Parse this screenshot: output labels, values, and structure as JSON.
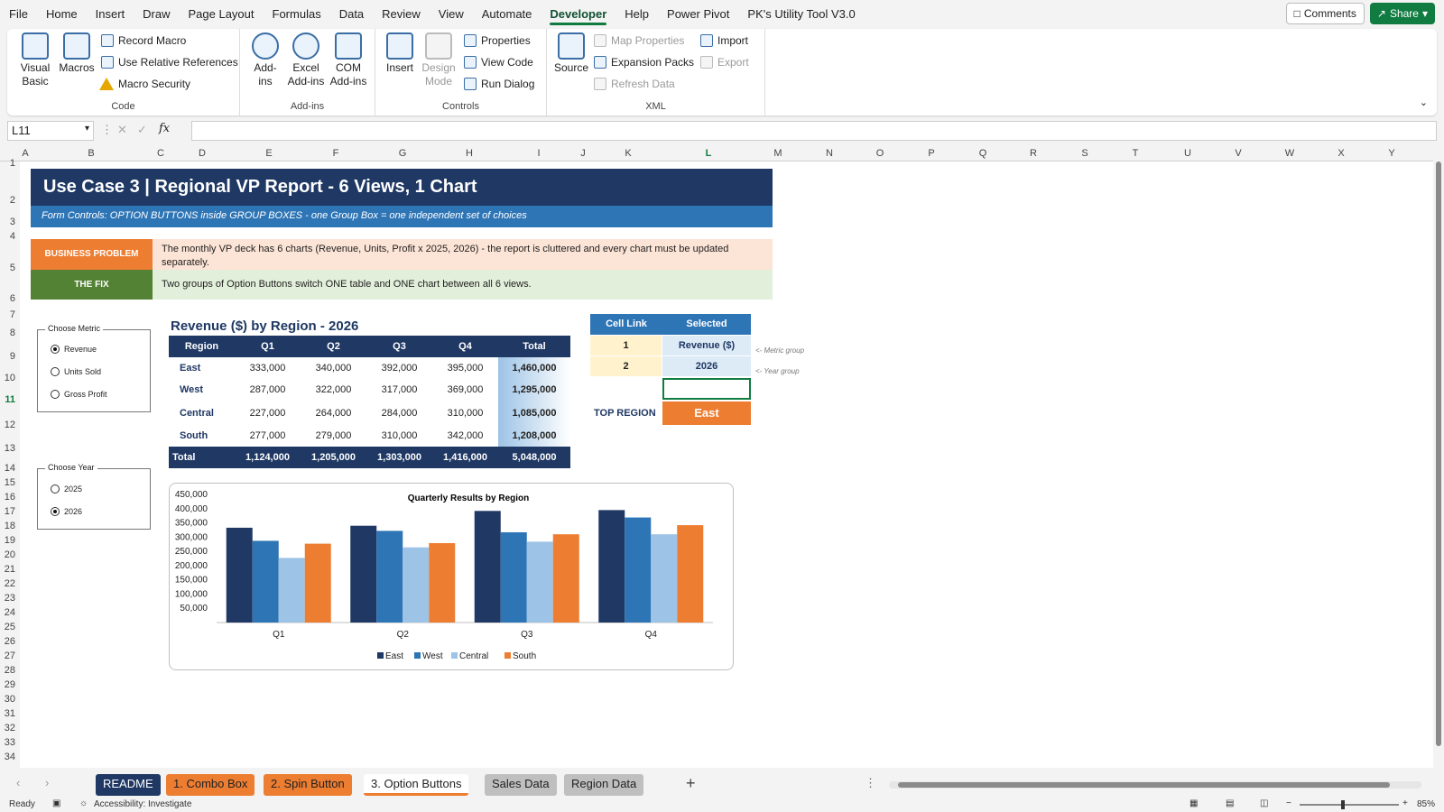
{
  "menu": {
    "tabs": [
      "File",
      "Home",
      "Insert",
      "Draw",
      "Page Layout",
      "Formulas",
      "Data",
      "Review",
      "View",
      "Automate",
      "Developer",
      "Help",
      "Power Pivot",
      "PK's Utility Tool V3.0"
    ],
    "active": "Developer",
    "comments": "Comments",
    "share": "Share"
  },
  "ribbon": {
    "code": {
      "label": "Code",
      "visual_basic": "Visual Basic",
      "macros": "Macros",
      "record_macro": "Record Macro",
      "relative_refs": "Use Relative References",
      "macro_security": "Macro Security"
    },
    "addins": {
      "label": "Add-ins",
      "addins": "Add-ins",
      "excel_addins": "Excel Add-ins",
      "com_addins": "COM Add-ins"
    },
    "controls": {
      "label": "Controls",
      "insert": "Insert",
      "design_mode": "Design Mode",
      "properties": "Properties",
      "view_code": "View Code",
      "run_dialog": "Run Dialog"
    },
    "xml": {
      "label": "XML",
      "source": "Source",
      "map_properties": "Map Properties",
      "expansion_packs": "Expansion Packs",
      "refresh_data": "Refresh Data",
      "import": "Import",
      "export": "Export"
    }
  },
  "formula_bar": {
    "name_box": "L11",
    "formula": ""
  },
  "columns": [
    "A",
    "B",
    "C",
    "D",
    "E",
    "F",
    "G",
    "H",
    "I",
    "J",
    "K",
    "L",
    "M",
    "N",
    "O",
    "P",
    "Q",
    "R",
    "S",
    "T",
    "U",
    "V",
    "W",
    "X",
    "Y"
  ],
  "rows": [
    "1",
    "2",
    "3",
    "4",
    "5",
    "6",
    "7",
    "8",
    "9",
    "10",
    "11",
    "12",
    "13",
    "14",
    "15",
    "16",
    "17",
    "18",
    "19",
    "20",
    "21",
    "22",
    "23",
    "24",
    "25",
    "26",
    "27",
    "28",
    "29",
    "30",
    "31",
    "32",
    "33",
    "34"
  ],
  "sheet": {
    "title": "Use Case 3  |  Regional VP Report - 6 Views, 1 Chart",
    "subtitle": "Form Controls: OPTION BUTTONS inside GROUP BOXES   -   one Group Box = one independent set of choices",
    "business_problem_label": "BUSINESS PROBLEM",
    "business_problem_text": "The monthly VP deck has 6 charts (Revenue, Units, Profit x 2025, 2026) - the report is cluttered and every chart must be updated separately.",
    "fix_label": "THE FIX",
    "fix_text": "Two groups of Option Buttons switch ONE table and ONE chart between all 6 views.",
    "metric_group": {
      "title": "Choose Metric",
      "options": [
        "Revenue",
        "Units Sold",
        "Gross Profit"
      ],
      "selected": 0
    },
    "year_group": {
      "title": "Choose Year",
      "options": [
        "2025",
        "2026"
      ],
      "selected": 1
    },
    "table_title": "Revenue ($)  by Region  -  2026",
    "table": {
      "headers": [
        "Region",
        "Q1",
        "Q2",
        "Q3",
        "Q4",
        "Total"
      ],
      "rows": [
        [
          "East",
          "333,000",
          "340,000",
          "392,000",
          "395,000",
          "1,460,000"
        ],
        [
          "West",
          "287,000",
          "322,000",
          "317,000",
          "369,000",
          "1,295,000"
        ],
        [
          "Central",
          "227,000",
          "264,000",
          "284,000",
          "310,000",
          "1,085,000"
        ],
        [
          "South",
          "277,000",
          "279,000",
          "310,000",
          "342,000",
          "1,208,000"
        ]
      ],
      "total": [
        "Total",
        "1,124,000",
        "1,205,000",
        "1,303,000",
        "1,416,000",
        "5,048,000"
      ]
    },
    "cell_link": {
      "headers": [
        "Cell Link",
        "Selected"
      ],
      "rows": [
        [
          "1",
          "Revenue ($)"
        ],
        [
          "2",
          "2026"
        ]
      ],
      "notes": [
        "<- Metric group",
        "<- Year group"
      ],
      "top_region_label": "TOP REGION",
      "top_region_value": "East"
    }
  },
  "colors": {
    "navy": "#1f3864",
    "blue": "#2e75b6",
    "light_blue": "#9dc3e6",
    "orange": "#ed7d31",
    "green": "#548235"
  },
  "chart_data": {
    "type": "bar",
    "title": "Quarterly Results by Region",
    "categories": [
      "Q1",
      "Q2",
      "Q3",
      "Q4"
    ],
    "series": [
      {
        "name": "East",
        "values": [
          333000,
          340000,
          392000,
          395000
        ],
        "color": "#1f3864"
      },
      {
        "name": "West",
        "values": [
          287000,
          322000,
          317000,
          369000
        ],
        "color": "#2e75b6"
      },
      {
        "name": "Central",
        "values": [
          227000,
          264000,
          284000,
          310000
        ],
        "color": "#9dc3e6"
      },
      {
        "name": "South",
        "values": [
          277000,
          279000,
          310000,
          342000
        ],
        "color": "#ed7d31"
      }
    ],
    "yticks": [
      "50,000",
      "100,000",
      "150,000",
      "200,000",
      "250,000",
      "300,000",
      "350,000",
      "400,000",
      "450,000"
    ],
    "ylim": [
      0,
      450000
    ],
    "legend": "bottom",
    "grid": false
  },
  "sheet_tabs": {
    "tabs": [
      "README",
      "1. Combo Box",
      "2. Spin Button",
      "3. Option Buttons",
      "Sales Data",
      "Region Data"
    ],
    "active": "3. Option Buttons"
  },
  "status": {
    "ready": "Ready",
    "accessibility": "Accessibility: Investigate",
    "zoom": "85%"
  }
}
